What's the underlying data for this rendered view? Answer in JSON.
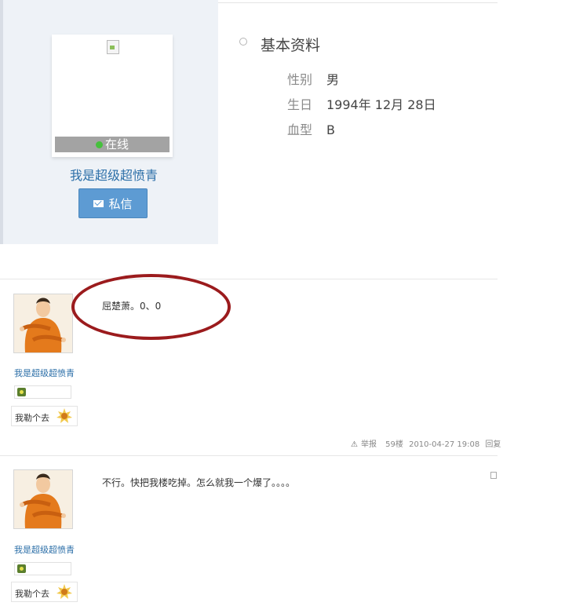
{
  "profile": {
    "online_label": "在线",
    "username": "我是超级超愤青",
    "message_button": "私信",
    "section_title": "基本资料",
    "fields": [
      {
        "label": "性别",
        "value": "男"
      },
      {
        "label": "生日",
        "value": "1994年 12月 28日"
      },
      {
        "label": "血型",
        "value": "B"
      }
    ]
  },
  "posts": [
    {
      "author": "我是超级超愤青",
      "title": "我勒个去",
      "content": "屈楚萧。0、0",
      "footer": {
        "report": "举报",
        "floor": "59楼",
        "timestamp": "2010-04-27 19:08",
        "reply": "回复"
      }
    },
    {
      "author": "我是超级超愤青",
      "title": "我勒个去",
      "content": "不行。快把我楼吃掉。怎么就我一个爆了。。。。"
    }
  ],
  "colors": {
    "link_blue": "#2c6fa8",
    "button_blue": "#5d9bd3",
    "annotation_red": "#9b1b1d",
    "online_green": "#46c03d"
  },
  "icons": [
    "mail-icon",
    "online-status-icon",
    "broken-image-icon",
    "level-icon",
    "rank-badge-icon",
    "warning-icon"
  ]
}
